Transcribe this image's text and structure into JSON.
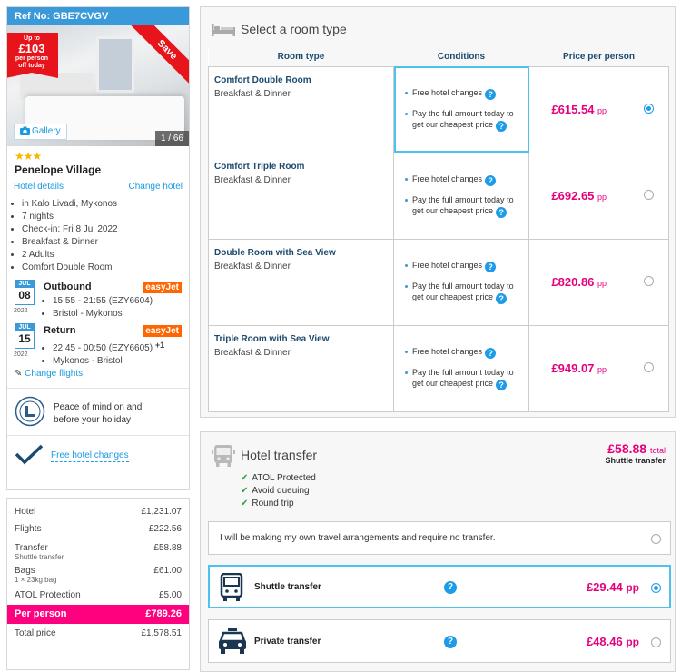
{
  "colors": {
    "accent": "#1a9ae0",
    "price": "#e6007e",
    "per_person_bar": "#ff007f",
    "save_badge": "#e8141b",
    "easyjet": "#ff6600"
  },
  "summary_card": {
    "ref": "Ref No: GBE7CVGV",
    "badge": {
      "up_to": "Up to",
      "amount": "£103",
      "line1": "per person",
      "line2": "off today"
    },
    "save": "Save",
    "gallery": "Gallery",
    "photo_count": "1 / 66",
    "stars": "★★★",
    "hotel_name": "Penelope Village",
    "hotel_details": "Hotel details",
    "change_hotel": "Change hotel",
    "facts": [
      "in Kalo Livadi, Mykonos",
      "7 nights",
      "Check-in: Fri 8 Jul 2022",
      "Breakfast & Dinner",
      "2 Adults",
      "Comfort Double Room"
    ],
    "outbound": {
      "month": "JUL",
      "day": "08",
      "year": "2022",
      "label": "Outbound",
      "airline": "easyJet",
      "time": "15:55 - 21:55 (EZY6604)",
      "route": "Bristol - Mykonos"
    },
    "return": {
      "month": "JUL",
      "day": "15",
      "year": "2022",
      "label": "Return",
      "airline": "easyJet",
      "time": "22:45 - 00:50 (EZY6605)",
      "plus": "+1",
      "route": "Mykonos - Bristol"
    },
    "change_flights": "Change flights",
    "atol_text": [
      "Peace of mind on and",
      "before your holiday"
    ],
    "free_changes": "Free hotel changes"
  },
  "price_summary": {
    "rows": [
      {
        "label": "Hotel",
        "value": "£1,231.07"
      },
      {
        "label": "Flights",
        "value": "£222.56"
      },
      {
        "label": "Transfer",
        "value": "£58.88",
        "sub": "Shuttle transfer"
      },
      {
        "label": "Bags",
        "value": "£61.00",
        "sub": "1 × 23kg bag"
      },
      {
        "label": "ATOL Protection",
        "value": "£5.00"
      }
    ],
    "per_person_label": "Per person",
    "per_person_value": "£789.26",
    "total_label": "Total price",
    "total_value": "£1,578.51"
  },
  "rooms": {
    "title": "Select a room type",
    "headers": [
      "Room type",
      "Conditions",
      "Price per person"
    ],
    "cond1": "Free hotel changes",
    "cond2": "Pay the full amount today to get our cheapest price",
    "pp": "pp",
    "items": [
      {
        "name": "Comfort Double Room",
        "board": "Breakfast & Dinner",
        "price": "£615.54",
        "selected": true
      },
      {
        "name": "Comfort Triple Room",
        "board": "Breakfast & Dinner",
        "price": "£692.65",
        "selected": false
      },
      {
        "name": "Double Room with Sea View",
        "board": "Breakfast & Dinner",
        "price": "£820.86",
        "selected": false
      },
      {
        "name": "Triple Room with Sea View",
        "board": "Breakfast & Dinner",
        "price": "£949.07",
        "selected": false
      }
    ]
  },
  "transfer": {
    "title": "Hotel transfer",
    "price": "£58.88",
    "total": "total",
    "type": "Shuttle transfer",
    "features": [
      "ATOL Protected",
      "Avoid queuing",
      "Round trip"
    ],
    "none_option": "I will be making my own travel arrangements and require no transfer.",
    "options": [
      {
        "name": "Shuttle transfer",
        "price": "£29.44",
        "pp": "pp",
        "selected": true
      },
      {
        "name": "Private transfer",
        "price": "£48.46",
        "pp": "pp",
        "selected": false
      }
    ]
  }
}
